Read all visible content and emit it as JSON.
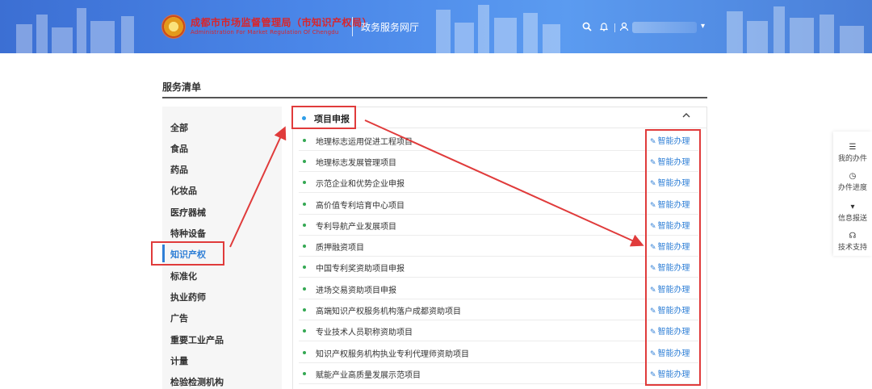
{
  "header": {
    "org_cn": "成都市市场监督管理局（市知识产权局）",
    "org_en": "Administration For Market Regulation Of Chengdu",
    "site_name": "政务服务网厅",
    "icons": [
      "search-icon",
      "bell-icon",
      "user-icon",
      "chevron-down-icon"
    ]
  },
  "page": {
    "title": "服务清单"
  },
  "sidebar": {
    "items": [
      {
        "label": "全部"
      },
      {
        "label": "食品"
      },
      {
        "label": "药品"
      },
      {
        "label": "化妆品"
      },
      {
        "label": "医疗器械"
      },
      {
        "label": "特种设备"
      },
      {
        "label": "知识产权",
        "active": true
      },
      {
        "label": "标准化"
      },
      {
        "label": "执业药师"
      },
      {
        "label": "广告"
      },
      {
        "label": "重要工业产品"
      },
      {
        "label": "计量"
      },
      {
        "label": "检验检测机构"
      }
    ]
  },
  "panel": {
    "title": "项目申报",
    "collapse_icon": "chevron-up-icon",
    "action_label": "智能办理",
    "action_icon": "edit-icon",
    "rows": [
      {
        "label": "地理标志运用促进工程项目"
      },
      {
        "label": "地理标志发展管理项目"
      },
      {
        "label": "示范企业和优势企业申报"
      },
      {
        "label": "高价值专利培育中心项目"
      },
      {
        "label": "专利导航产业发展项目"
      },
      {
        "label": "质押融资项目"
      },
      {
        "label": "中国专利奖资助项目申报"
      },
      {
        "label": "进场交易资助项目申报"
      },
      {
        "label": "高端知识产权服务机构落户成都资助项目"
      },
      {
        "label": "专业技术人员职称资助项目"
      },
      {
        "label": "知识产权服务机构执业专利代理师资助项目"
      },
      {
        "label": "赋能产业高质量发展示范项目"
      }
    ]
  },
  "float_bar": {
    "items": [
      {
        "label": "我的办件",
        "icon": "list-icon"
      },
      {
        "label": "办件进度",
        "icon": "clock-icon"
      },
      {
        "label": "信息报送",
        "icon": "caret-down-icon"
      },
      {
        "label": "技术支持",
        "icon": "headset-icon"
      }
    ]
  },
  "colors": {
    "header_blue": "#4a86e8",
    "link_blue": "#2f7fd6",
    "highlight_red": "#e03b3b",
    "dot_green": "#34a853"
  }
}
